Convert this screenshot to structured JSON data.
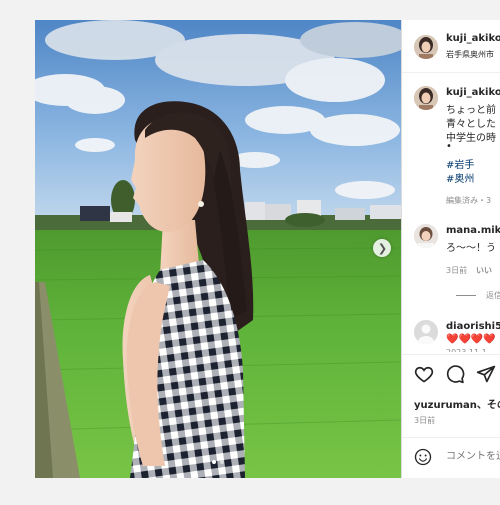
{
  "post_header": {
    "username": "kuji_akiko",
    "location": "岩手県奥州市"
  },
  "caption": {
    "username": "kuji_akiko",
    "lines": [
      "ちょっと前",
      "青々とした",
      "中学生の時",
      "•"
    ],
    "hashtags": [
      "#岩手",
      "#奥州"
    ],
    "meta": "編集済み・3"
  },
  "comments": [
    {
      "username": "mana.miki",
      "text": "ろ〜〜！う",
      "time": "3日前",
      "action": "いい",
      "replies_label": "返信"
    },
    {
      "username": "diaorishi5",
      "text": "❤️❤️❤️❤️",
      "partial": "2023 11 1"
    }
  ],
  "liked_by": "yuzuruman、その",
  "post_age": "3日前",
  "comment_box": {
    "placeholder": "コメントを追"
  },
  "icons": {
    "like": "heart-icon",
    "comment": "comment-icon",
    "share": "paper-plane-icon",
    "emoji": "emoji-icon",
    "next": "chevron-right-icon"
  },
  "carousel": {
    "slides": 2,
    "active_index": 0
  },
  "colors": {
    "hashtag": "#00376b",
    "secondary_text": "#8e8e8e"
  }
}
